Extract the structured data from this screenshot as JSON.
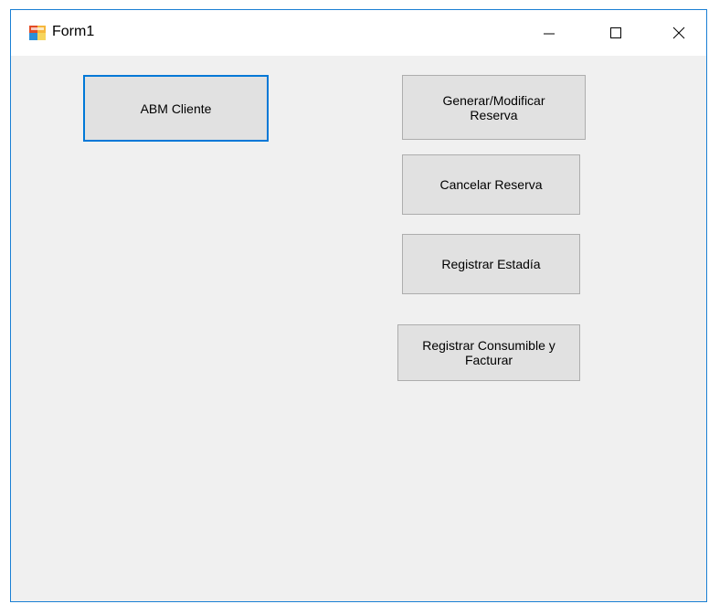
{
  "window": {
    "title": "Form1",
    "icon": "winforms-app-icon",
    "accent_color": "#0078d7",
    "controls": {
      "minimize_icon": "minimize-icon",
      "maximize_icon": "maximize-icon",
      "close_icon": "close-icon"
    }
  },
  "buttons": {
    "abm_cliente": "ABM Cliente",
    "generar_line1": "Generar/Modificar",
    "generar_line2": "Reserva",
    "cancelar": "Cancelar Reserva",
    "estadia": "Registrar Estadía",
    "consumible_line1": "Registrar Consumible y",
    "consumible_line2": "Facturar"
  }
}
